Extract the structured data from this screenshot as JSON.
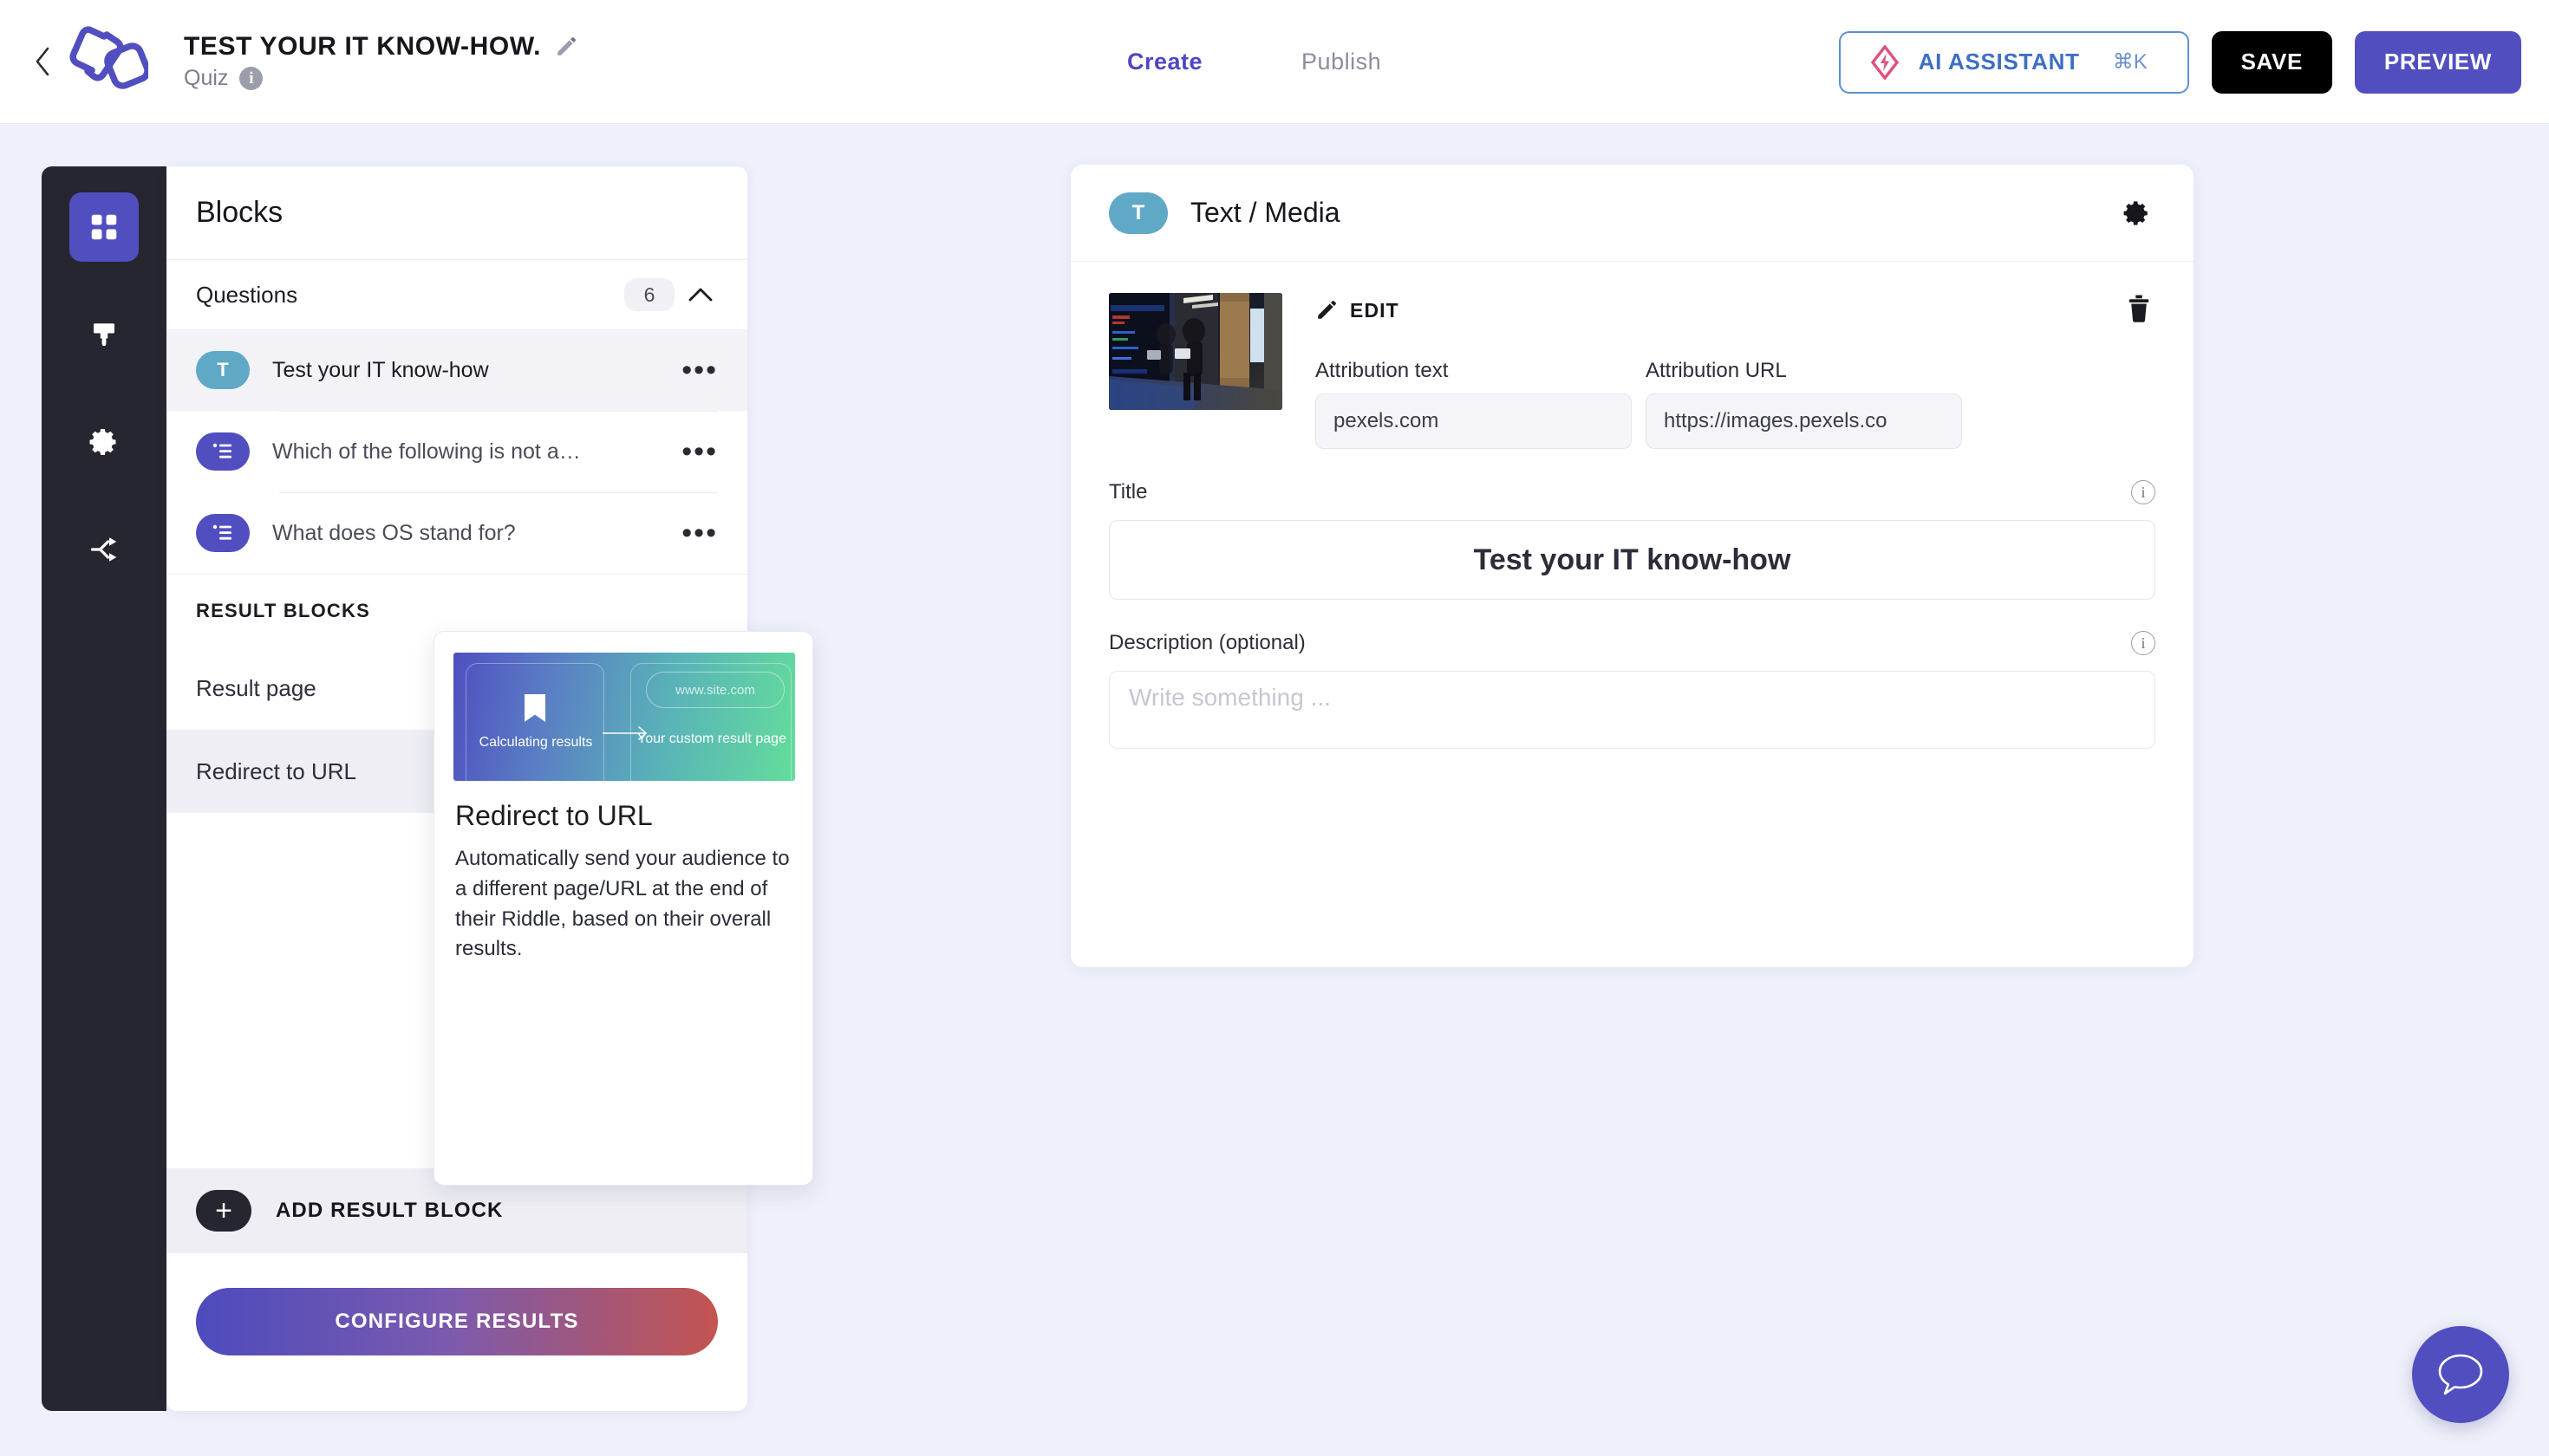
{
  "topbar": {
    "back_icon": "chevron-left-icon",
    "logo_icon": "riddle-logo",
    "doc_title": "TEST YOUR IT KNOW-HOW.",
    "edit_title_icon": "pencil-icon",
    "subtitle": "Quiz",
    "info_icon": "info-icon",
    "info_glyph": "i",
    "tabs": [
      {
        "label": "Create",
        "active": true
      },
      {
        "label": "Publish",
        "active": false
      }
    ],
    "ai_button": {
      "label": "AI ASSISTANT",
      "shortcut": "⌘K",
      "icon": "ai-spark-icon",
      "accent": "#3d6fc4",
      "icon_color": "#e0507f"
    },
    "save_label": "SAVE",
    "preview_label": "PREVIEW",
    "preview_color": "#514fc0"
  },
  "rail": {
    "items": [
      {
        "icon": "grid-blocks-icon",
        "active": true
      },
      {
        "icon": "paint-brush-icon",
        "active": false
      },
      {
        "icon": "gear-icon",
        "active": false
      },
      {
        "icon": "share-branch-icon",
        "active": false
      }
    ],
    "active_color": "#514fc0",
    "background": "#262630"
  },
  "blocks_panel": {
    "heading": "Blocks",
    "questions_section": {
      "label": "Questions",
      "count": "6",
      "collapse_icon": "chevron-up-icon",
      "items": [
        {
          "badge": "T",
          "badge_kind": "text",
          "badge_color": "#5fa9c6",
          "label": "Test your IT know-how",
          "selected": true,
          "menu": "•••"
        },
        {
          "badge": "list",
          "badge_kind": "list",
          "badge_color": "#514fc0",
          "label": "Which of the following is not a…",
          "selected": false,
          "menu": "•••"
        },
        {
          "badge": "list",
          "badge_kind": "list",
          "badge_color": "#514fc0",
          "label": "What does OS stand for?",
          "selected": false,
          "menu": "•••"
        }
      ]
    },
    "result_section": {
      "label": "RESULT BLOCKS",
      "items": [
        {
          "label": "Result page",
          "selected": false
        },
        {
          "label": "Redirect to URL",
          "selected": true
        }
      ]
    },
    "add_result_block": {
      "label": "ADD RESULT BLOCK",
      "icon": "plus-icon"
    },
    "configure_results": {
      "label": "CONFIGURE RESULTS"
    }
  },
  "tooltip": {
    "preview": {
      "left_caption": "Calculating results",
      "right_caption": "Your custom result page",
      "url_text": "www.site.com",
      "bookmark_icon": "bookmark-icon",
      "arrow_icon": "arrow-right-icon"
    },
    "title": "Redirect to URL",
    "body": "Automatically send your audience to a different page/URL at the end of their Riddle, based on their overall results."
  },
  "main_card": {
    "badge": "T",
    "badge_color": "#5fa9c6",
    "title": "Text / Media",
    "settings_icon": "gear-icon",
    "media": {
      "thumbnail_alt": "server-room-photo",
      "edit_label": "EDIT",
      "edit_icon": "pencil-icon",
      "delete_icon": "trash-icon",
      "attribution_text_label": "Attribution text",
      "attribution_text_value": "pexels.com",
      "attribution_url_label": "Attribution URL",
      "attribution_url_value": "https://images.pexels.co"
    },
    "title_field": {
      "label": "Title",
      "value": "Test your IT know-how",
      "info_icon": "info-icon",
      "info_glyph": "i"
    },
    "description_field": {
      "label": "Description (optional)",
      "value": "",
      "placeholder": "Write something ...",
      "info_icon": "info-icon",
      "info_glyph": "i"
    }
  },
  "chat": {
    "icon": "chat-bubble-icon",
    "color": "#514fc0"
  }
}
